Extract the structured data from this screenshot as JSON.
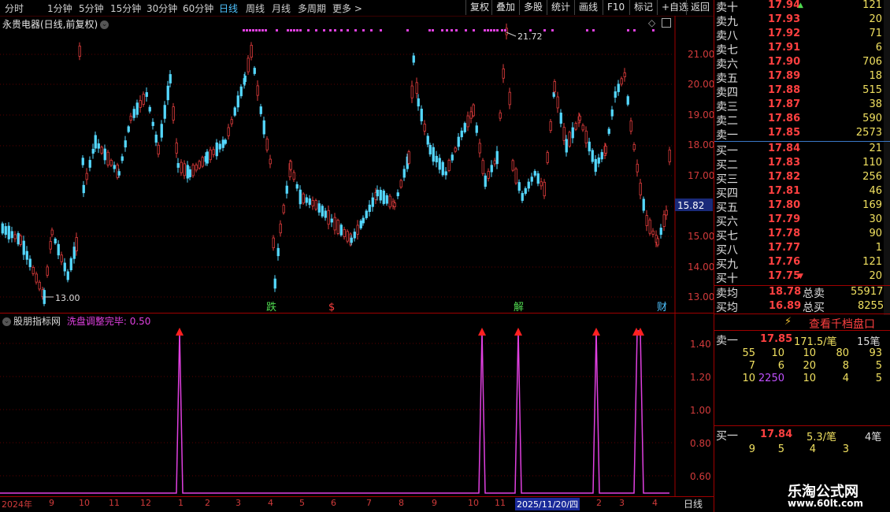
{
  "toolbar": {
    "periods": [
      "分时",
      "1分钟",
      "5分钟",
      "15分钟",
      "30分钟",
      "60分钟",
      "日线",
      "周线",
      "月线",
      "多周期",
      "更多 >"
    ],
    "active_period": "日线",
    "buttons": [
      "复权",
      "叠加",
      "多股",
      "统计",
      "画线",
      "F10",
      "标记",
      "+自选",
      "返回"
    ]
  },
  "main_chart": {
    "title": "永贵电器(日线,前复权)",
    "y_ticks": [
      "21.00",
      "20.00",
      "19.00",
      "18.00",
      "17.00",
      "16.00",
      "15.00",
      "14.00",
      "13.00"
    ],
    "current_price": "15.82",
    "high_label": "21.72",
    "low_label": "13.00",
    "markers": [
      {
        "text": "跌",
        "color": "#4fd84f"
      },
      {
        "text": "$",
        "color": "#ff4040"
      },
      {
        "text": "解",
        "color": "#4fd84f"
      },
      {
        "text": "财",
        "color": "#4fc3ff"
      }
    ]
  },
  "indicator": {
    "name": "股朋指标网",
    "line_label": "洗盘调整完毕: 0.50",
    "y_ticks": [
      "1.40",
      "1.20",
      "1.00",
      "0.80",
      "0.60"
    ],
    "line_color": "#e040e0"
  },
  "x_axis": {
    "labels": [
      "2024年",
      "9",
      "10",
      "11",
      "12",
      "1",
      "2",
      "3",
      "4",
      "5",
      "6",
      "7",
      "8",
      "9",
      "10",
      "11",
      "2025/11/20/四",
      "2",
      "3",
      "4"
    ],
    "period_label": "日线"
  },
  "order_book": {
    "asks": [
      {
        "label": "卖十",
        "price": "17.94",
        "vol": "121"
      },
      {
        "label": "卖九",
        "price": "17.93",
        "vol": "20"
      },
      {
        "label": "卖八",
        "price": "17.92",
        "vol": "71"
      },
      {
        "label": "卖七",
        "price": "17.91",
        "vol": "6"
      },
      {
        "label": "卖六",
        "price": "17.90",
        "vol": "706"
      },
      {
        "label": "卖五",
        "price": "17.89",
        "vol": "18"
      },
      {
        "label": "卖四",
        "price": "17.88",
        "vol": "515"
      },
      {
        "label": "卖三",
        "price": "17.87",
        "vol": "38"
      },
      {
        "label": "卖二",
        "price": "17.86",
        "vol": "590"
      },
      {
        "label": "卖一",
        "price": "17.85",
        "vol": "2573"
      }
    ],
    "bids": [
      {
        "label": "买一",
        "price": "17.84",
        "vol": "21"
      },
      {
        "label": "买二",
        "price": "17.83",
        "vol": "110"
      },
      {
        "label": "买三",
        "price": "17.82",
        "vol": "256"
      },
      {
        "label": "买四",
        "price": "17.81",
        "vol": "46"
      },
      {
        "label": "买五",
        "price": "17.80",
        "vol": "169"
      },
      {
        "label": "买六",
        "price": "17.79",
        "vol": "30"
      },
      {
        "label": "买七",
        "price": "17.78",
        "vol": "90"
      },
      {
        "label": "买八",
        "price": "17.77",
        "vol": "1"
      },
      {
        "label": "买九",
        "price": "17.76",
        "vol": "121"
      },
      {
        "label": "买十",
        "price": "17.75",
        "vol": "20"
      }
    ],
    "avg_sell_label": "卖均",
    "avg_sell": "18.78",
    "total_sell_label": "总卖",
    "total_sell": "55917",
    "avg_buy_label": "买均",
    "avg_buy": "16.89",
    "total_buy_label": "总买",
    "total_buy": "8255"
  },
  "queue": {
    "view_button": "查看千档盘口",
    "sell1_label": "卖一",
    "sell1_price": "17.85",
    "sell1_avg": "171.5/笔",
    "sell1_count": "15笔",
    "sell_rows": [
      [
        "55",
        "10",
        "10",
        "80",
        "93"
      ],
      [
        "7",
        "6",
        "20",
        "8",
        "5"
      ],
      [
        "10",
        "2250",
        "10",
        "4",
        "5"
      ]
    ],
    "buy1_label": "买一",
    "buy1_price": "17.84",
    "buy1_avg": "5.3/笔",
    "buy1_count": "4笔",
    "buy_rows": [
      [
        "9",
        "5",
        "4",
        "3"
      ]
    ]
  },
  "watermark": {
    "line1": "乐淘公式网",
    "line2": "www.60lt.com"
  }
}
